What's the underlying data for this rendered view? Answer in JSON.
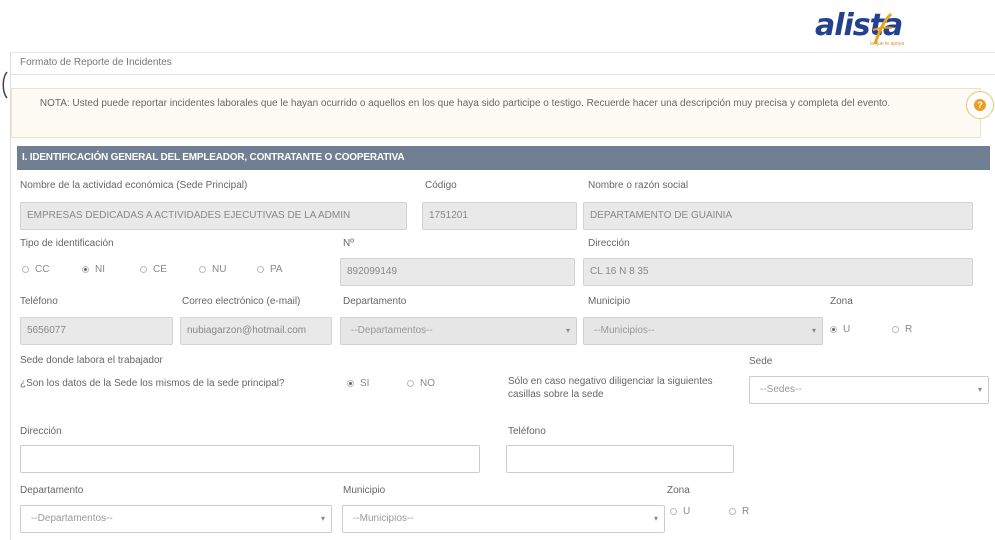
{
  "logo": {
    "text": "alista",
    "tagline": "la que te apoya"
  },
  "format_title": "Formato de Reporte de Incidentes",
  "note": "NOTA: Usted puede reportar incidentes laborales que le hayan ocurrido o aquellos en los que haya sido participe o testigo. Recuerde hacer una descripción muy precisa y completa del evento.",
  "help_icon": "?",
  "section_title": "I. IDENTIFICACIÓN GENERAL DEL EMPLEADOR, CONTRATANTE O COOPERATIVA",
  "labels": {
    "economic_activity": "Nombre de la actividad económica (Sede Principal)",
    "code": "Código",
    "company_name": "Nombre o razón social",
    "id_type": "Tipo de identificación",
    "number": "Nº",
    "address": "Dirección",
    "phone": "Teléfono",
    "email": "Correo electrónico (e-mail)",
    "department": "Departamento",
    "municipality": "Municipio",
    "zone": "Zona",
    "worker_site": "Sede donde labora el trabajador",
    "same_site_question": "¿Son los datos de la Sede los mismos de la sede principal?",
    "negative_case": "Sólo en caso negativo diligenciar la siguientes casillas sobre la sede",
    "site": "Sede",
    "address2": "Dirección",
    "phone2": "Teléfono",
    "department2": "Departamento",
    "municipality2": "Municipio",
    "zone2": "Zona"
  },
  "values": {
    "economic_activity": "EMPRESAS DEDICADAS A ACTIVIDADES EJECUTIVAS DE LA ADMIN",
    "code": "1751201",
    "company_name": "DEPARTAMENTO DE GUAINIA",
    "number": "892099149",
    "address": "CL 16 N 8 35",
    "phone": "5656077",
    "email": "nubiagarzon@hotmail.com",
    "address2": "",
    "phone2": ""
  },
  "id_types": [
    "CC",
    "NI",
    "CE",
    "NU",
    "PA"
  ],
  "id_type_selected": "NI",
  "selects": {
    "department": "--Departamentos--",
    "municipality": "--Municipios--",
    "site": "--Sedes--",
    "department2": "--Departamentos--",
    "municipality2": "--Municipios--"
  },
  "zones": [
    "U",
    "R"
  ],
  "zone_selected": "U",
  "same_site_options": [
    "SI",
    "NO"
  ],
  "same_site_selected": "SI",
  "caret_icon": "▾"
}
